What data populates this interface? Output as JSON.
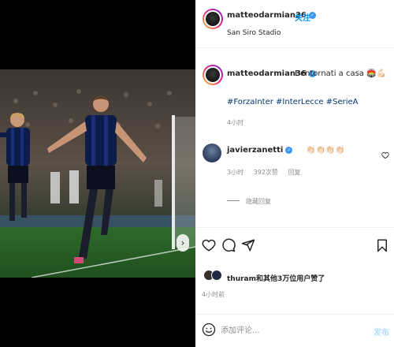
{
  "header": {
    "username": "matteodarmian36",
    "follow_label": "关注",
    "location": "San Siro Stadio"
  },
  "caption": {
    "username": "matteodarmian36",
    "text": "Bentornati a casa 🏟️💪🏻",
    "hashtags": "#ForzaInter #InterLecce #SerieA",
    "time": "4小时"
  },
  "comment": {
    "username": "javierzanetti",
    "text": "👏🏻👏🏻👏🏻👏🏻",
    "time": "3小时",
    "likes": "392次赞",
    "reply_label": "回复",
    "hide_replies_label": "隐藏回复"
  },
  "likes_summary": {
    "first_user": "thuram",
    "rest": "和其他3万位用户赞了"
  },
  "post_time": "4小时前",
  "comment_box": {
    "placeholder": "添加评论...",
    "post_label": "发布"
  },
  "icons": {
    "like": "heart-icon",
    "comment": "comment-icon",
    "share": "send-icon",
    "save": "bookmark-icon",
    "emoji": "smiley-icon",
    "carousel": "chevron-right-icon"
  },
  "colors": {
    "link": "#0095f6",
    "hashtag": "#00376b",
    "muted": "#8e8e8e",
    "verified": "#3897f0"
  }
}
